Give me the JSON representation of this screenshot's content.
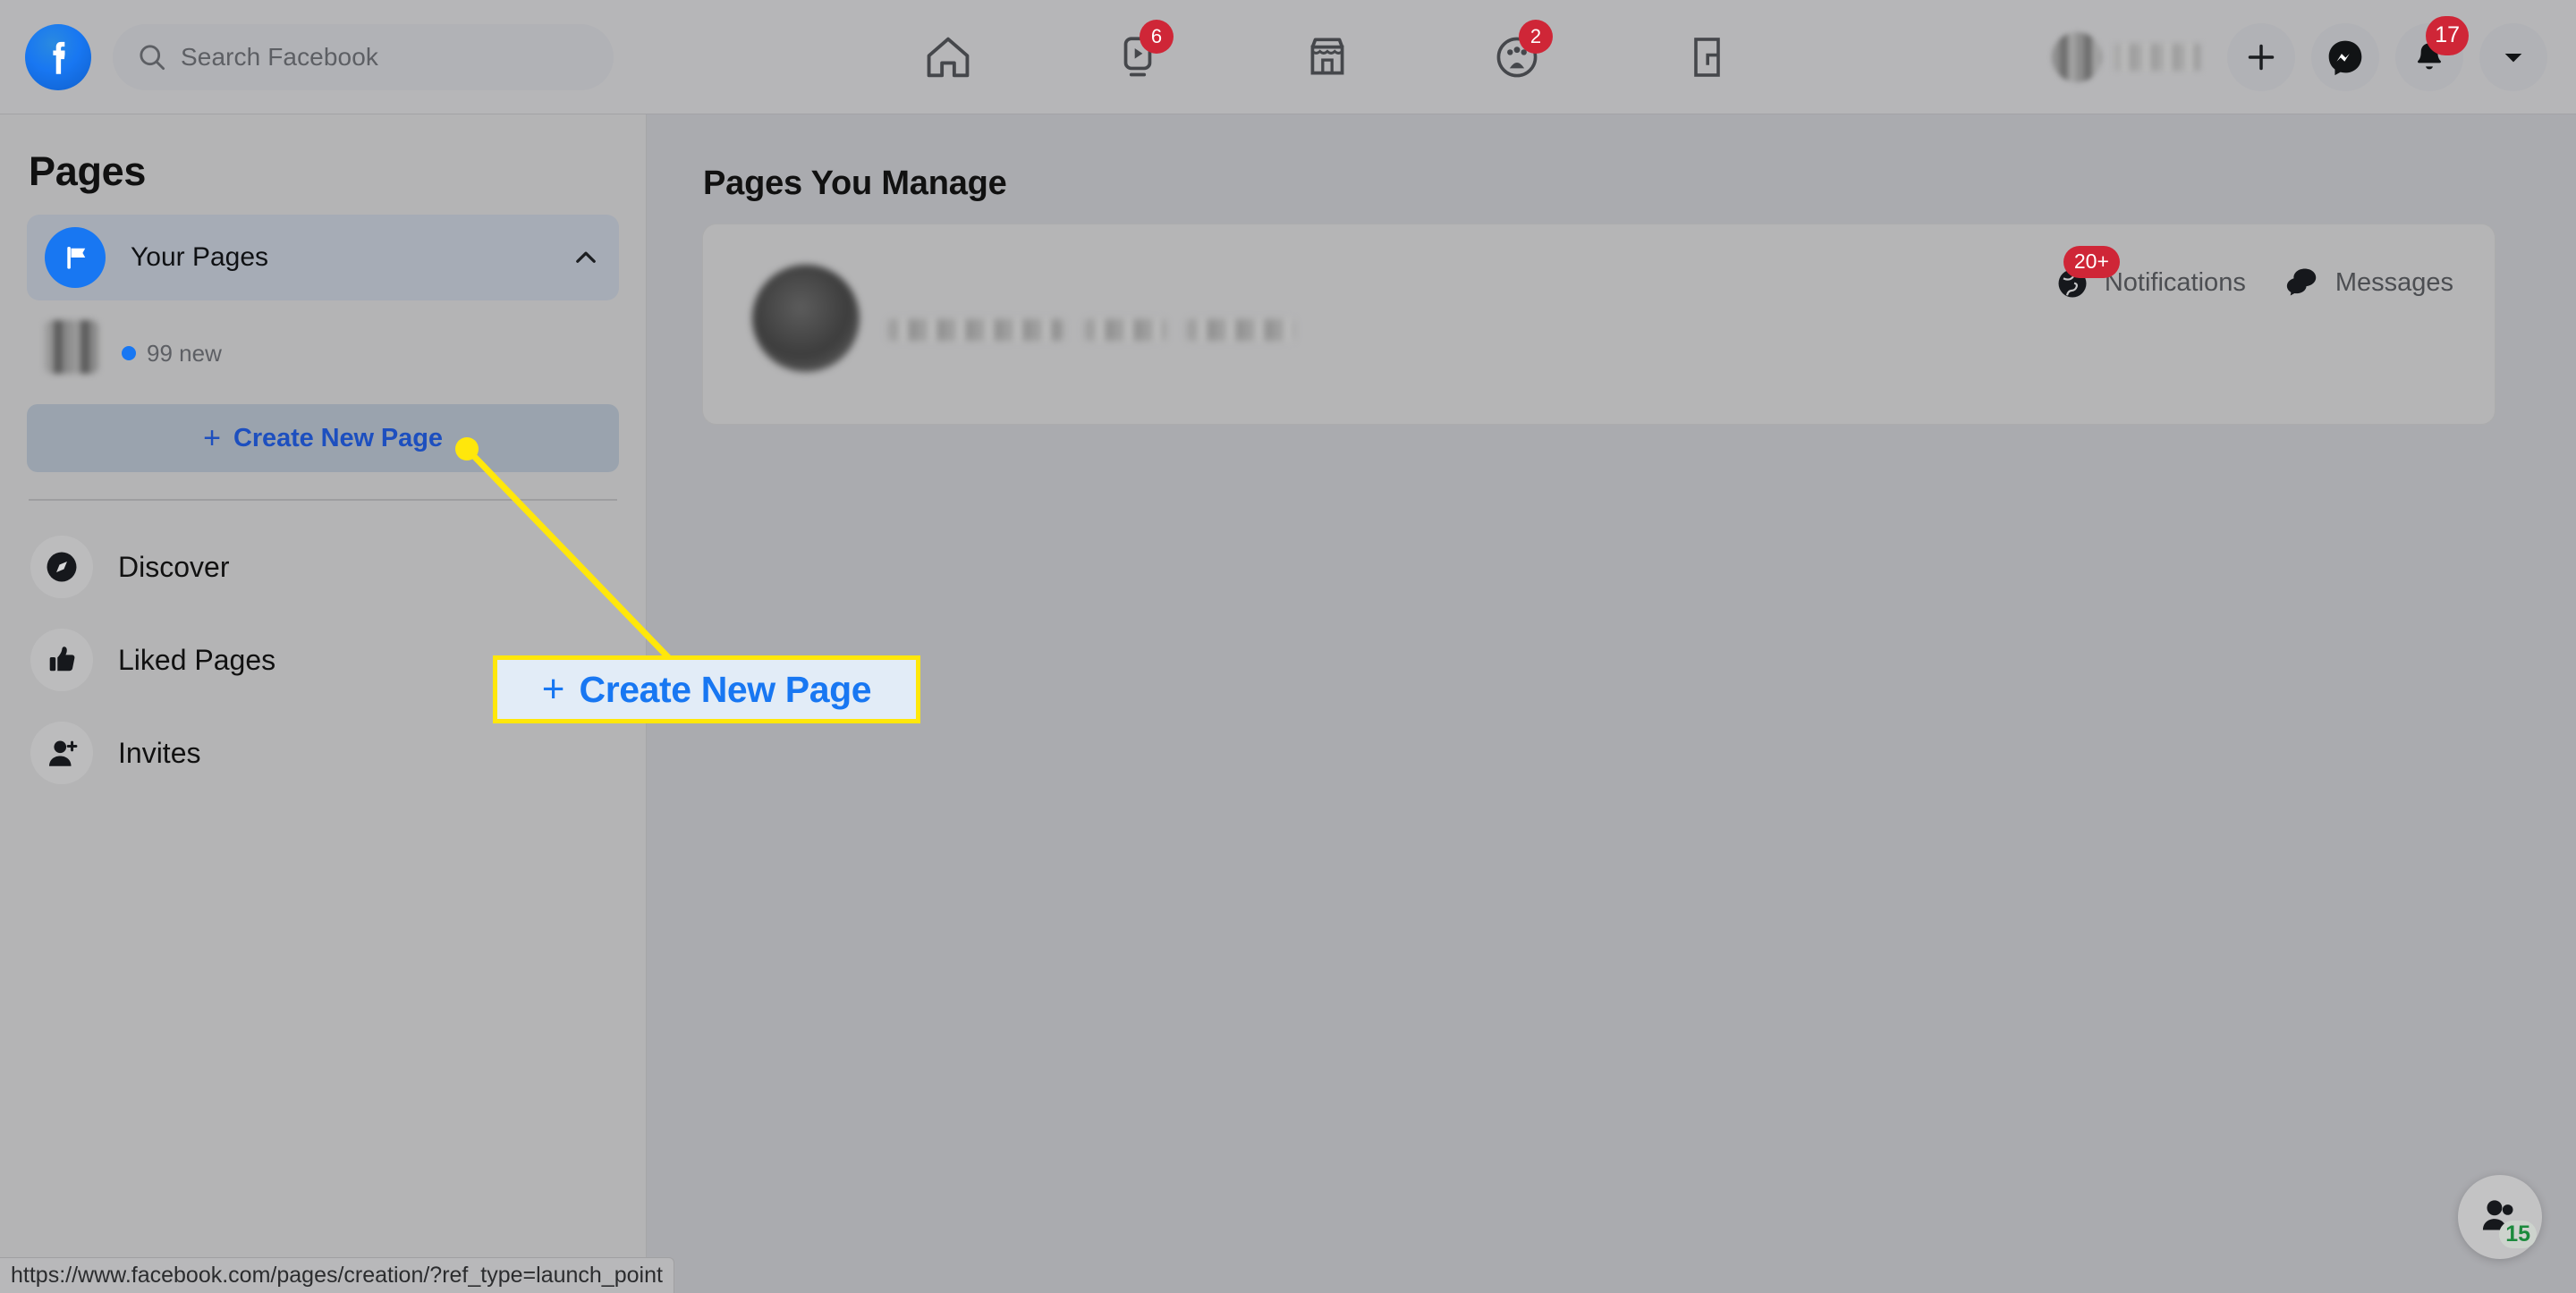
{
  "topbar": {
    "logo_icon": "facebook-logo-icon",
    "search": {
      "placeholder": "Search Facebook",
      "value": "",
      "icon": "search-icon"
    },
    "nav": [
      {
        "name": "home",
        "icon": "home-icon",
        "badge": ""
      },
      {
        "name": "video",
        "icon": "video-icon",
        "badge": "6"
      },
      {
        "name": "marketplace",
        "icon": "marketplace-icon",
        "badge": ""
      },
      {
        "name": "groups",
        "icon": "groups-icon",
        "badge": "2"
      },
      {
        "name": "gaming",
        "icon": "gaming-icon",
        "badge": ""
      }
    ],
    "account": {
      "name_redacted": true
    },
    "actions": [
      {
        "name": "create-menu",
        "icon": "plus-icon",
        "badge": ""
      },
      {
        "name": "messenger",
        "icon": "messenger-icon",
        "badge": ""
      },
      {
        "name": "notifications",
        "icon": "bell-icon",
        "badge": "17"
      },
      {
        "name": "account-menu",
        "icon": "chevron-down-icon",
        "badge": ""
      }
    ]
  },
  "sidebar": {
    "title": "Pages",
    "your_pages": {
      "label": "Your Pages",
      "icon": "flag-icon",
      "chevron": "chevron-up-icon",
      "expanded": true
    },
    "managed_page": {
      "name_redacted": true,
      "new_count": "99 new"
    },
    "create_new_page": {
      "plus": "+",
      "label": "Create New Page"
    },
    "items": [
      {
        "label": "Discover",
        "icon": "compass-icon"
      },
      {
        "label": "Liked Pages",
        "icon": "thumbs-up-icon"
      },
      {
        "label": "Invites",
        "icon": "person-add-icon"
      }
    ]
  },
  "main": {
    "title": "Pages You Manage",
    "card": {
      "avatar_redacted": true,
      "name_redacted": true,
      "actions": [
        {
          "label": "Notifications",
          "icon": "globe-icon",
          "badge": "20+"
        },
        {
          "label": "Messages",
          "icon": "messages-icon",
          "badge": ""
        }
      ]
    }
  },
  "annotation": {
    "callout": {
      "plus": "+",
      "label": "Create New Page"
    },
    "highlight_color": "#ffe70b",
    "callout_bg": "#e2ecf7",
    "callout_text_color": "#1877f2"
  },
  "contacts_fab": {
    "icon": "contacts-icon",
    "badge": "15",
    "badge_color": "#1b8a3c"
  },
  "statusbar": {
    "url": "https://www.facebook.com/pages/creation/?ref_type=launch_point"
  }
}
